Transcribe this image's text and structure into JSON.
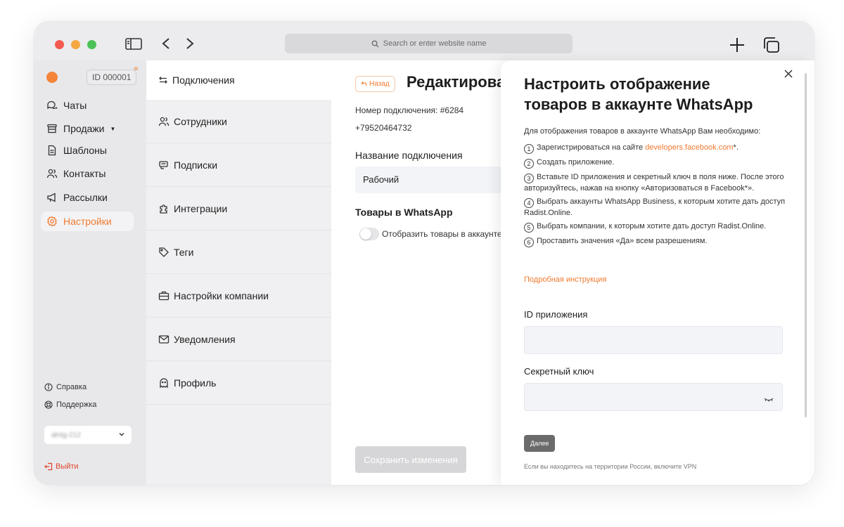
{
  "browser": {
    "url_placeholder": "Search or enter website name"
  },
  "sidebar": {
    "account_id": "ID 000001",
    "items": [
      {
        "label": "Чаты",
        "icon": "chat-icon"
      },
      {
        "label": "Продажи",
        "icon": "store-icon"
      },
      {
        "label": "Шаблоны",
        "icon": "document-icon"
      },
      {
        "label": "Контакты",
        "icon": "contacts-icon"
      },
      {
        "label": "Рассылки",
        "icon": "megaphone-icon"
      },
      {
        "label": "Настройки",
        "icon": "gear-icon"
      }
    ],
    "help_label": "Справка",
    "support_label": "Поддержка",
    "company_value": "alntg-212",
    "logout_label": "Выйти"
  },
  "settings_menu": {
    "items": [
      {
        "label": "Подключения",
        "icon": "connections-icon"
      },
      {
        "label": "Сотрудники",
        "icon": "users-icon"
      },
      {
        "label": "Подписки",
        "icon": "subscriptions-icon"
      },
      {
        "label": "Интеграции",
        "icon": "puzzle-icon"
      },
      {
        "label": "Теги",
        "icon": "tag-icon"
      },
      {
        "label": "Настройки компании",
        "icon": "briefcase-icon"
      },
      {
        "label": "Уведомления",
        "icon": "mail-icon"
      },
      {
        "label": "Профиль",
        "icon": "profile-icon"
      }
    ]
  },
  "connection": {
    "back_label": "Назад",
    "title": "Редактирование подключения",
    "number_line": "Номер подключения: #6284",
    "phone": "+79520464732",
    "name_label": "Название подключения",
    "name_value": "Рабочий",
    "products_heading": "Товары в WhatsApp",
    "toggle_label": "Отобразить товары в аккаунте",
    "save_label": "Сохранить изменения"
  },
  "drawer": {
    "title": "Настроить отображение товаров в аккаунте WhatsApp",
    "intro": "Для отображения товаров в аккаунте WhatsApp Вам необходимо:",
    "step1_text": "Зарегистрироваться на сайте",
    "step1_link": "developers.facebook.com",
    "step1_suffix": "*.",
    "steps": [
      "Создать приложение.",
      "Вставьте ID приложения и секретный ключ в поля ниже. После этого авторизуйтесь, нажав на кнопку «Авторизоваться в Facebook*».",
      "Выбрать аккаунты WhatsApp Business, к которым хотите дать доступ Radist.Online.",
      "Выбрать компании, к которым хотите дать доступ Radist.Online.",
      "Проставить значения «Да» всем разрешениям."
    ],
    "numbers": [
      "1",
      "2",
      "3",
      "4",
      "5",
      "6"
    ],
    "detail_link": "Подробная инструкция",
    "app_id_label": "ID приложения",
    "secret_label": "Секретный ключ",
    "next_label": "Далее",
    "vpn_note": "Если вы находитесь на территории России, включите VPN"
  },
  "colors": {
    "accent": "#ef7a30",
    "logout": "#e0442a",
    "traffic_red": "#f35a50",
    "traffic_yellow": "#f5a742",
    "traffic_green": "#4bc256"
  }
}
